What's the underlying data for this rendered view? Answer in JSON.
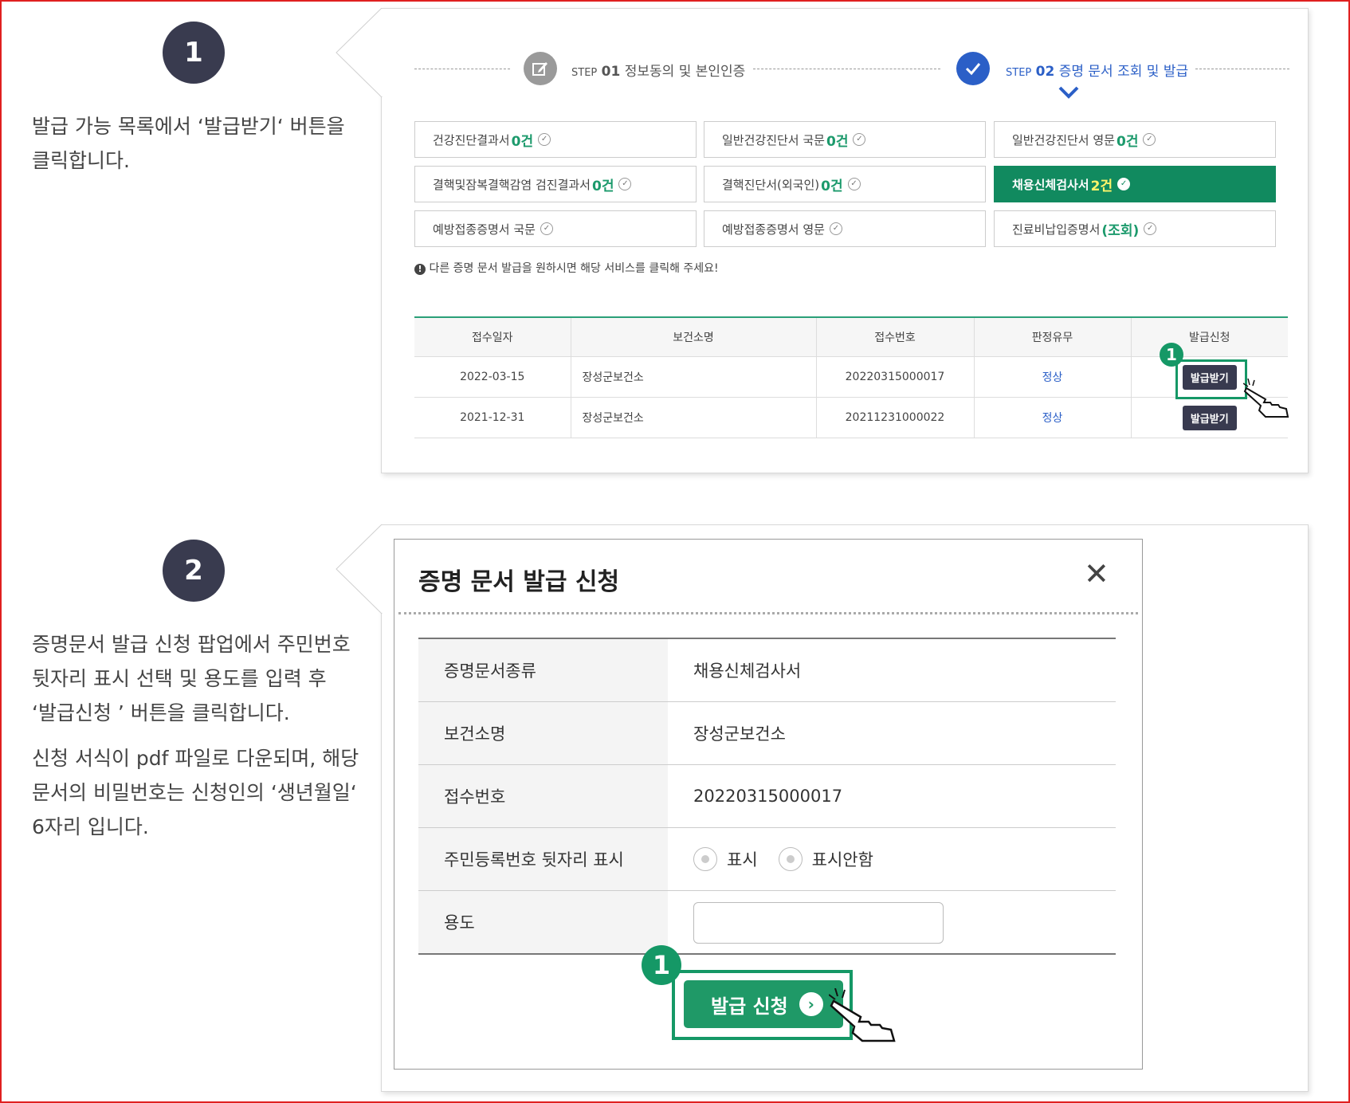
{
  "step1": {
    "badge": "1",
    "text_line1": "발급 가능 목록에서 ‘발급받기‘ 버튼을",
    "text_line2": "클릭합니다."
  },
  "step2": {
    "badge": "2",
    "text_line1": "증명문서 발급 신청 팝업에서 주민번호",
    "text_line2": "뒷자리 표시 선택 및 용도를 입력 후",
    "text_line3": "‘발급신청 ’ 버튼을 클릭합니다.",
    "text_line4": "신청 서식이 pdf 파일로 다운되며, 해당",
    "text_line5": "문서의 비밀번호는 신청인의 ‘생년월일‘",
    "text_line6": "6자리 입니다."
  },
  "progress": {
    "step01_prefix": "STEP",
    "step01_num": "01",
    "step01_label": "정보동의 및 본인인증",
    "step02_prefix": "STEP",
    "step02_num": "02",
    "step02_label": "증명 문서 조회 및 발급"
  },
  "cert_tabs": [
    {
      "label": "건강진단결과서",
      "count": "0건"
    },
    {
      "label": "일반건강진단서 국문",
      "count": "0건"
    },
    {
      "label": "일반건강진단서 영문",
      "count": "0건"
    },
    {
      "label": "결핵및잠복결핵감염 검진결과서",
      "count": "0건"
    },
    {
      "label": "결핵진단서(외국인)",
      "count": "0건"
    },
    {
      "label": "채용신체검사서",
      "count": "2건"
    },
    {
      "label": "예방접종증명서 국문",
      "count": ""
    },
    {
      "label": "예방접종증명서 영문",
      "count": ""
    },
    {
      "label": "진료비납입증명서",
      "count": "(조회)"
    }
  ],
  "notice": "다른 증명 문서 발급을 원하시면 해당 서비스를 클릭해 주세요!",
  "table": {
    "headers": [
      "접수일자",
      "보건소명",
      "접수번호",
      "판정유무",
      "발급신청"
    ],
    "rows": [
      {
        "date": "2022-03-15",
        "center": "장성군보건소",
        "number": "20220315000017",
        "result": "정상",
        "button": "발급받기"
      },
      {
        "date": "2021-12-31",
        "center": "장성군보건소",
        "number": "20211231000022",
        "result": "정상",
        "button": "발급받기"
      }
    ]
  },
  "marker_num": "1",
  "modal": {
    "title": "증명 문서 발급 신청",
    "close": "✕",
    "rows": {
      "type_label": "증명문서종류",
      "type_value": "채용신체검사서",
      "center_label": "보건소명",
      "center_value": "장성군보건소",
      "number_label": "접수번호",
      "number_value": "20220315000017",
      "rrn_label": "주민등록번호 뒷자리 표시",
      "rrn_opt1": "표시",
      "rrn_opt2": "표시안함",
      "purpose_label": "용도"
    },
    "submit_label": "발급 신청"
  },
  "colors": {
    "accent": "#118a5f",
    "badge": "#393b4f",
    "step_active": "#2b5fc7"
  }
}
